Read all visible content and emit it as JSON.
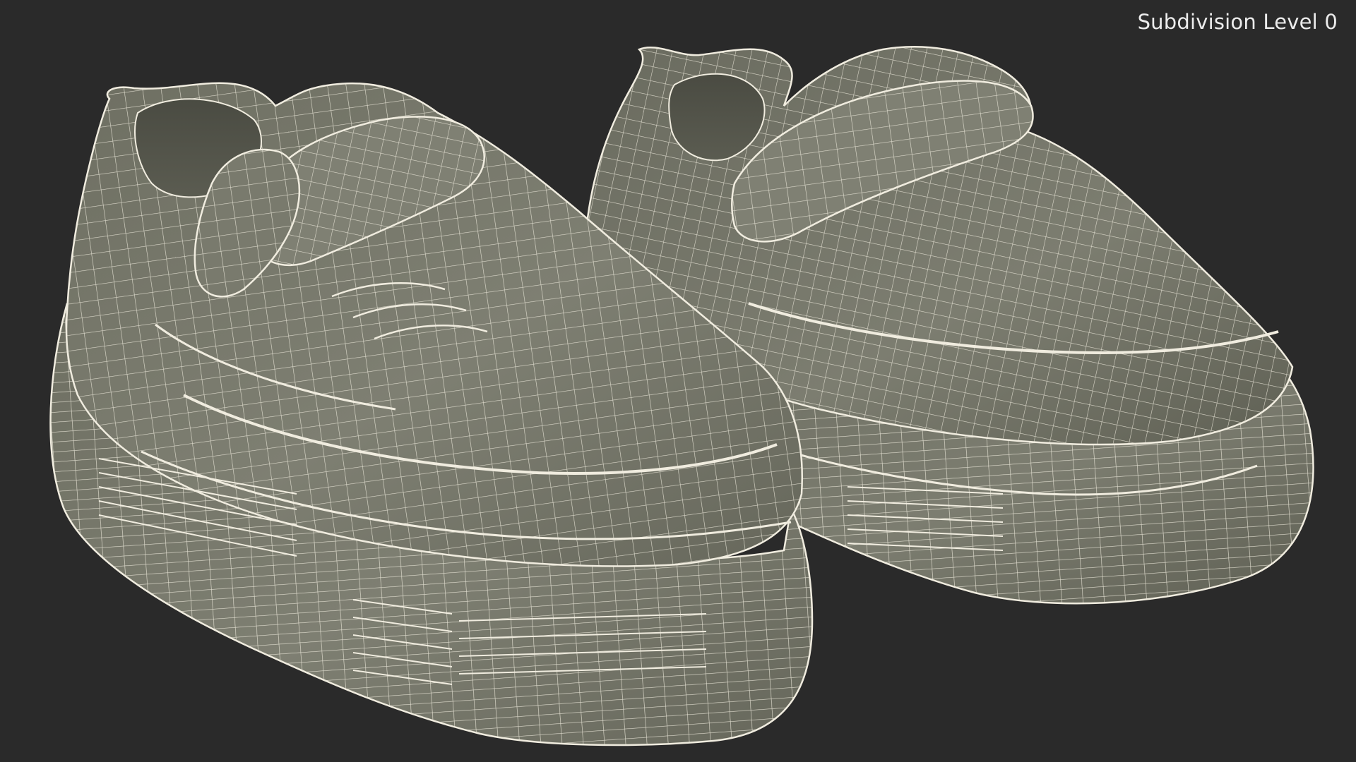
{
  "viewport": {
    "overlay_label": "Subdivision Level 0",
    "background_color": "#2a2a2a",
    "mesh_color": "#7b7b6e",
    "wire_color": "#f2efe3"
  },
  "scene": {
    "objects": [
      {
        "name": "left shoe",
        "render": "wireframe-on-shaded"
      },
      {
        "name": "right shoe",
        "render": "wireframe-on-shaded"
      }
    ]
  }
}
